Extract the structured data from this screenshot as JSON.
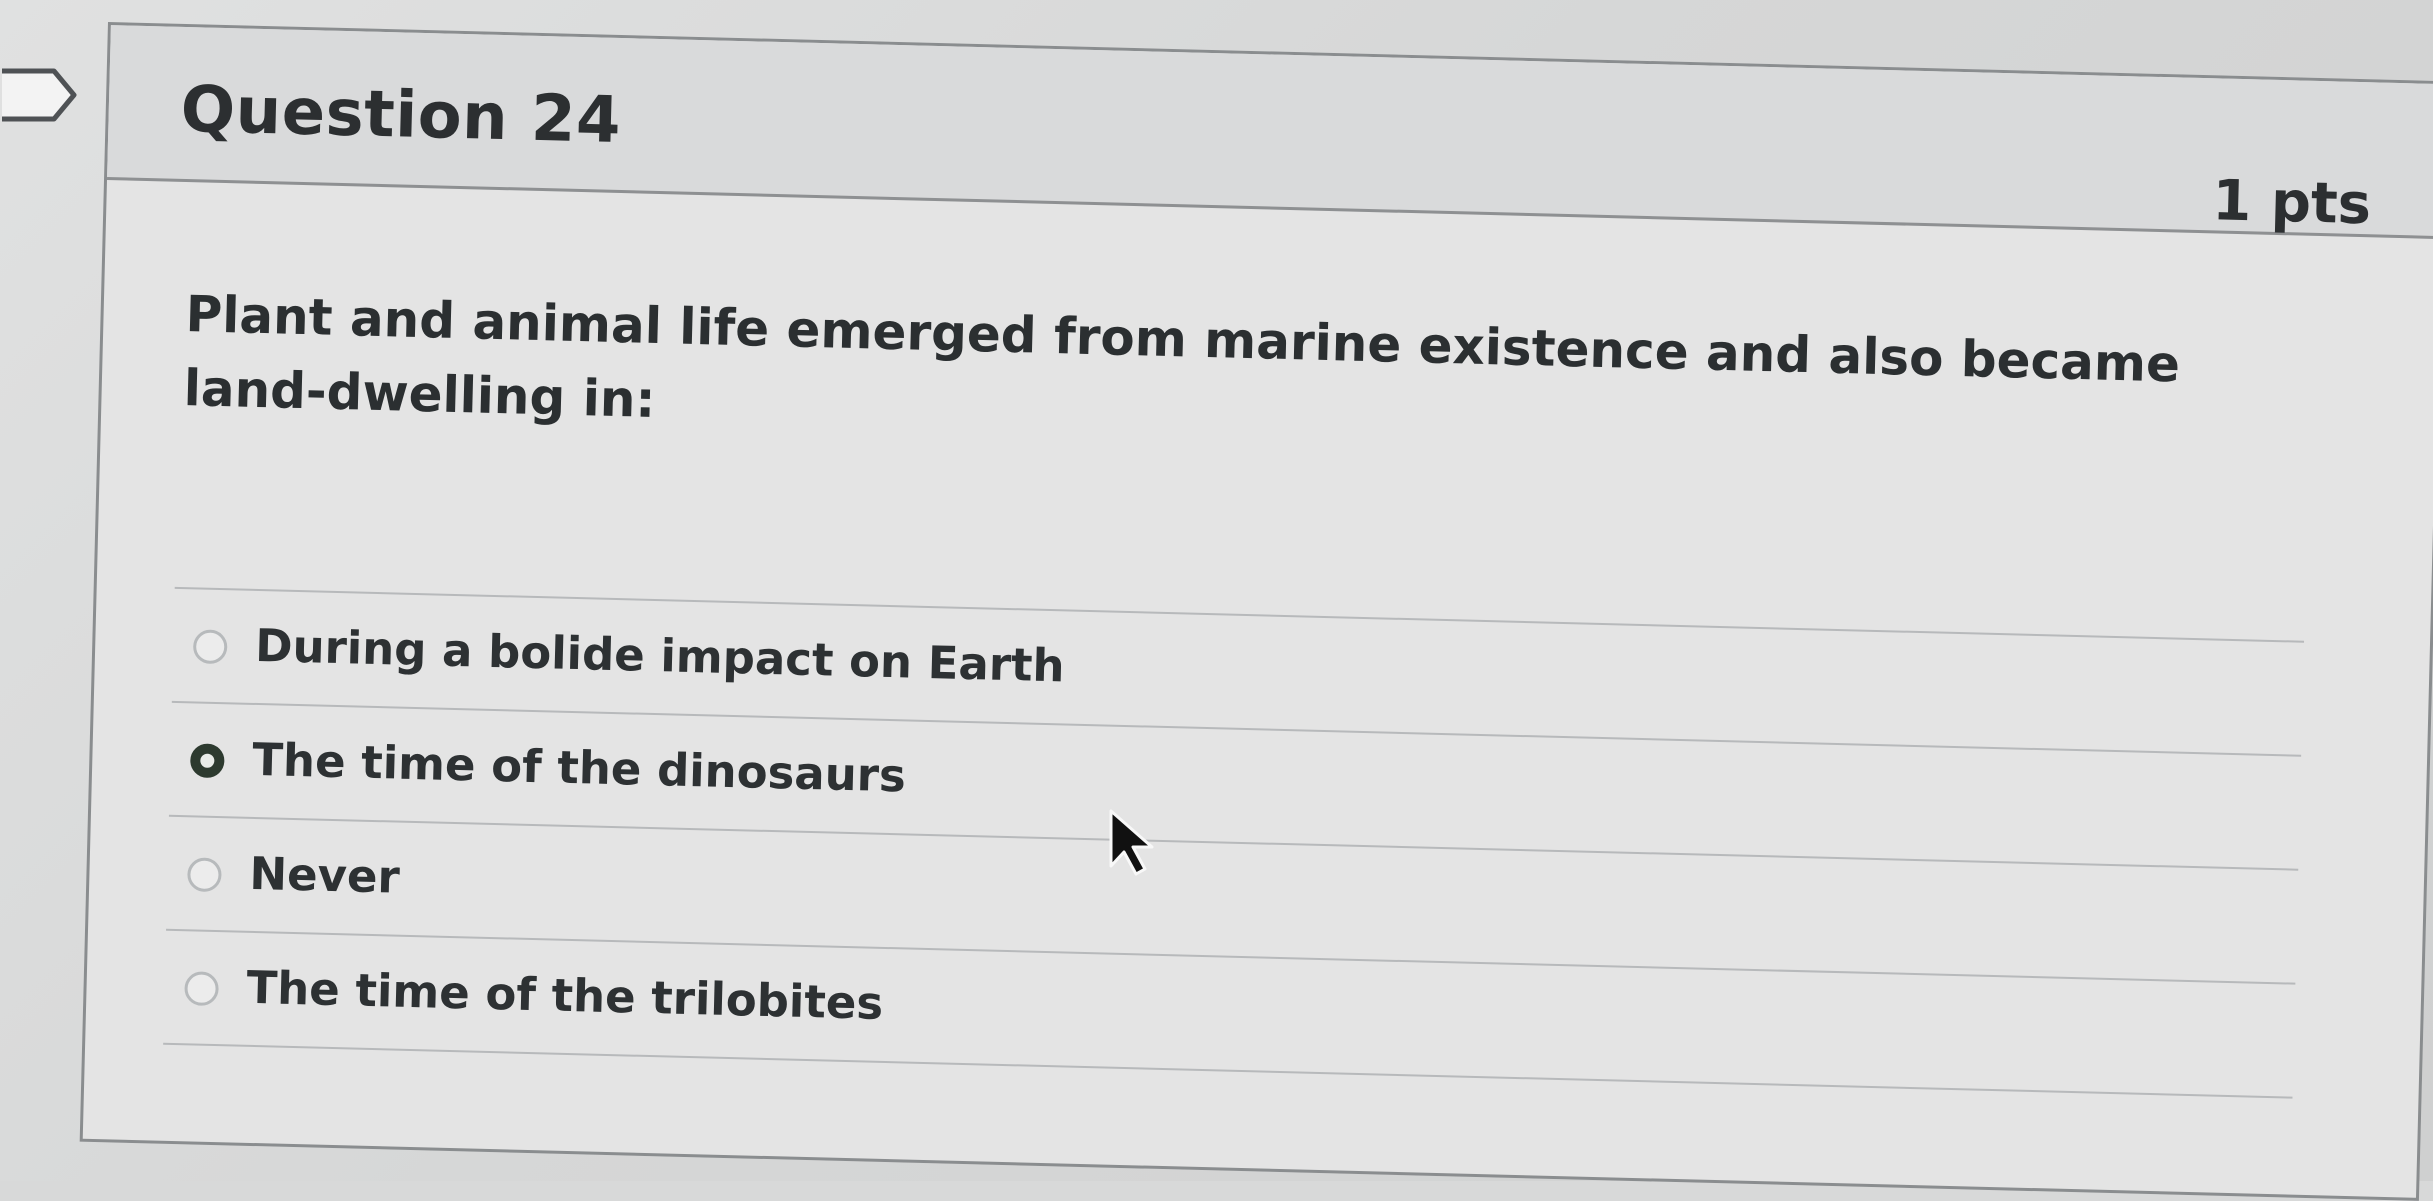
{
  "question": {
    "title": "Question 24",
    "points": "1 pts",
    "text": "Plant and animal life emerged from marine existence and also became land-dwelling in:"
  },
  "answers": [
    {
      "label": "During a bolide impact on Earth",
      "selected": false
    },
    {
      "label": "The time of the dinosaurs",
      "selected": true
    },
    {
      "label": "Never",
      "selected": false
    },
    {
      "label": "The time of the trilobites",
      "selected": false
    }
  ],
  "icons": {
    "flag": "flag-icon",
    "cursor": "mouse-pointer-icon",
    "radio": "radio-button-icon"
  },
  "colors": {
    "card_background": "#e4e4e4",
    "header_background": "#d9dadb",
    "border": "#8a8d8f",
    "selected_radio": "#2d3a2f",
    "text": "#2d3133"
  }
}
